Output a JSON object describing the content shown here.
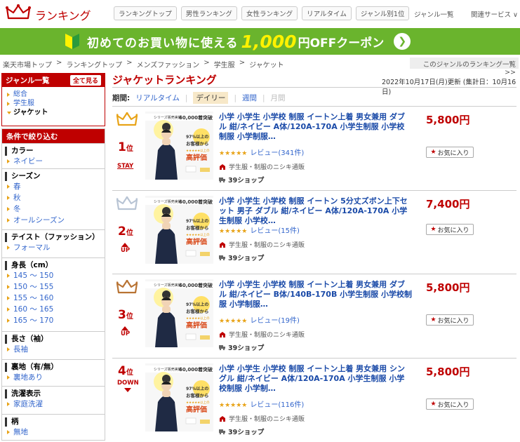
{
  "header": {
    "logo_text": "ランキング",
    "nav": [
      "ランキングトップ",
      "男性ランキング",
      "女性ランキング",
      "リアルタイム",
      "ジャンル別1位"
    ],
    "genre_list": "ジャンル一覧",
    "services": "関連サービス ∨"
  },
  "banner": {
    "text1": "初めてのお買い物に使える",
    "text2": "1,000",
    "text3": "円OFFクーポン",
    "arrow": "❯"
  },
  "breadcrumb": [
    "楽天市場トップ",
    "ランキングトップ",
    "メンズファッション",
    "学生服",
    "ジャケット"
  ],
  "breadcrumb_sep": ">",
  "genre_ranking_link": "このジャンルのランキング一覧 >>",
  "sidebar": {
    "genre_head": "ジャンル一覧",
    "show_all": "全て見る",
    "genres": [
      "総合",
      "学生服",
      "ジャケット"
    ],
    "filter_head": "条件で絞り込む",
    "sections": [
      {
        "title": "カラー",
        "items": [
          "ネイビー"
        ]
      },
      {
        "title": "シーズン",
        "items": [
          "春",
          "秋",
          "冬",
          "オールシーズン"
        ]
      },
      {
        "title": "テイスト（ファッション）",
        "items": [
          "フォーマル"
        ]
      },
      {
        "title": "身長（cm）",
        "items": [
          "145 ～ 150",
          "150 ～ 155",
          "155 ～ 160",
          "160 ～ 165",
          "165 ～ 170"
        ]
      },
      {
        "title": "長さ（袖）",
        "items": [
          "長袖"
        ]
      },
      {
        "title": "裏地（有/無）",
        "items": [
          "裏地あり"
        ]
      },
      {
        "title": "洗濯表示",
        "items": [
          "家庭洗濯"
        ]
      },
      {
        "title": "柄",
        "items": [
          "無地"
        ]
      }
    ]
  },
  "page": {
    "title": "ジャケットランキング",
    "updated": "2022年10月17日(月)更新 (集計日：10月16日)",
    "period_label": "期間:",
    "periods": [
      "リアルタイム",
      "デイリー",
      "週間",
      "月間"
    ],
    "sep": "|"
  },
  "items": [
    {
      "rank": "1",
      "rank_suffix": "位",
      "status": "STAY",
      "title": "小学 小学生 小学校 制服 イートン上着 男女兼用 ダブル 紺/ネイビー A体/120A-170A 小学生制服 小学校制服 小学制服…",
      "price": "5,800円",
      "stars": "★★★★★",
      "reviews": "レビュー(341件)",
      "shop": "学生服・制服のニシキ通販",
      "shop_badge": "39ショップ",
      "fav": "お気に入り"
    },
    {
      "rank": "2",
      "rank_suffix": "位",
      "status": "UP",
      "title": "小学 小学生 小学校 制服 イートン 5分丈ズボン上下セット 男子 ダブル 紺/ネイビー A体/120A-170A 小学生制服 小学校…",
      "price": "7,400円",
      "stars": "★★★★★",
      "reviews": "レビュー(15件)",
      "shop": "学生服・制服のニシキ通販",
      "shop_badge": "39ショップ",
      "fav": "お気に入り"
    },
    {
      "rank": "3",
      "rank_suffix": "位",
      "status": "UP",
      "title": "小学 小学生 小学校 制服 イートン上着 男女兼用 ダブル 紺/ネイビー B体/140B-170B 小学生制服 小学校制服 小学制服…",
      "price": "5,800円",
      "stars": "★★★★★",
      "reviews": "レビュー(19件)",
      "shop": "学生服・制服のニシキ通販",
      "shop_badge": "39ショップ",
      "fav": "お気に入り"
    },
    {
      "rank": "4",
      "rank_suffix": "位",
      "status": "DOWN",
      "title": "小学 小学生 小学校 制服 イートン上着 男女兼用 シングル 紺/ネイビー A体/120A-170A 小学生制服 小学校制服 小学制…",
      "price": "5,800円",
      "stars": "★★★★★",
      "reviews": "レビュー(116件)",
      "shop": "学生服・制服のニシキ通販",
      "shop_badge": "39ショップ",
      "fav": "お気に入り"
    }
  ],
  "thumb": {
    "line1": "シリーズ販売実績",
    "line2": "60,000着突破",
    "line3": "97%以上の",
    "line4": "お客様から",
    "line5": "★★★★★以上の",
    "line6": "高評価"
  },
  "colors": {
    "accent": "#bf0000",
    "link": "#1a4aa8",
    "banner": "#6ab42d",
    "gold": "#e8a317",
    "silver": "#b8c4d4",
    "bronze": "#b87333"
  }
}
